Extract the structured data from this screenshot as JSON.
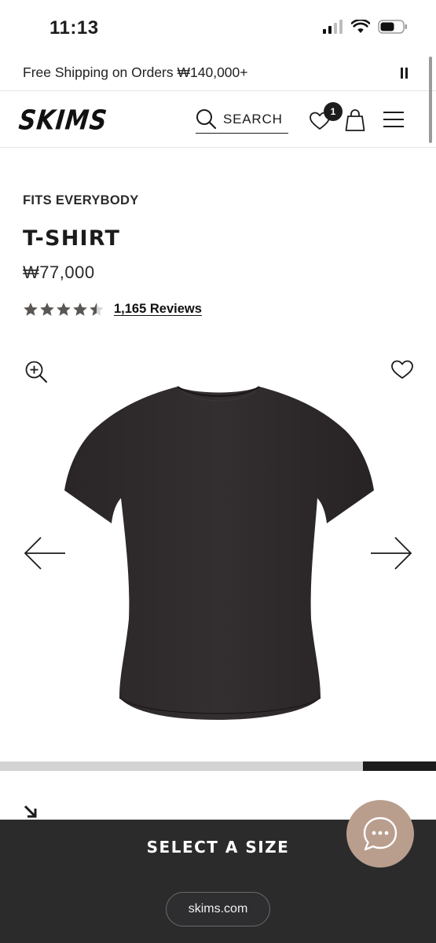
{
  "status": {
    "time": "11:13"
  },
  "promo": {
    "text": "Free Shipping on Orders ₩140,000+"
  },
  "header": {
    "logo": "SKIMS",
    "search_label": "SEARCH",
    "wishlist_count": "1"
  },
  "product": {
    "eyebrow": "FITS EVERYBODY",
    "title": "T-SHIRT",
    "price": "₩77,000",
    "rating": 4.5,
    "reviews_label": "1,165 Reviews"
  },
  "gallery": {
    "progress_start": 0.833,
    "progress_end": 1.0
  },
  "bottom": {
    "cta_label": "SELECT A SIZE",
    "url": "skims.com"
  },
  "colors": {
    "primary": "#1c1c1c",
    "panel": "#2b2b2c",
    "chat_bubble": "#b99e8e",
    "star": "#5a5653"
  }
}
